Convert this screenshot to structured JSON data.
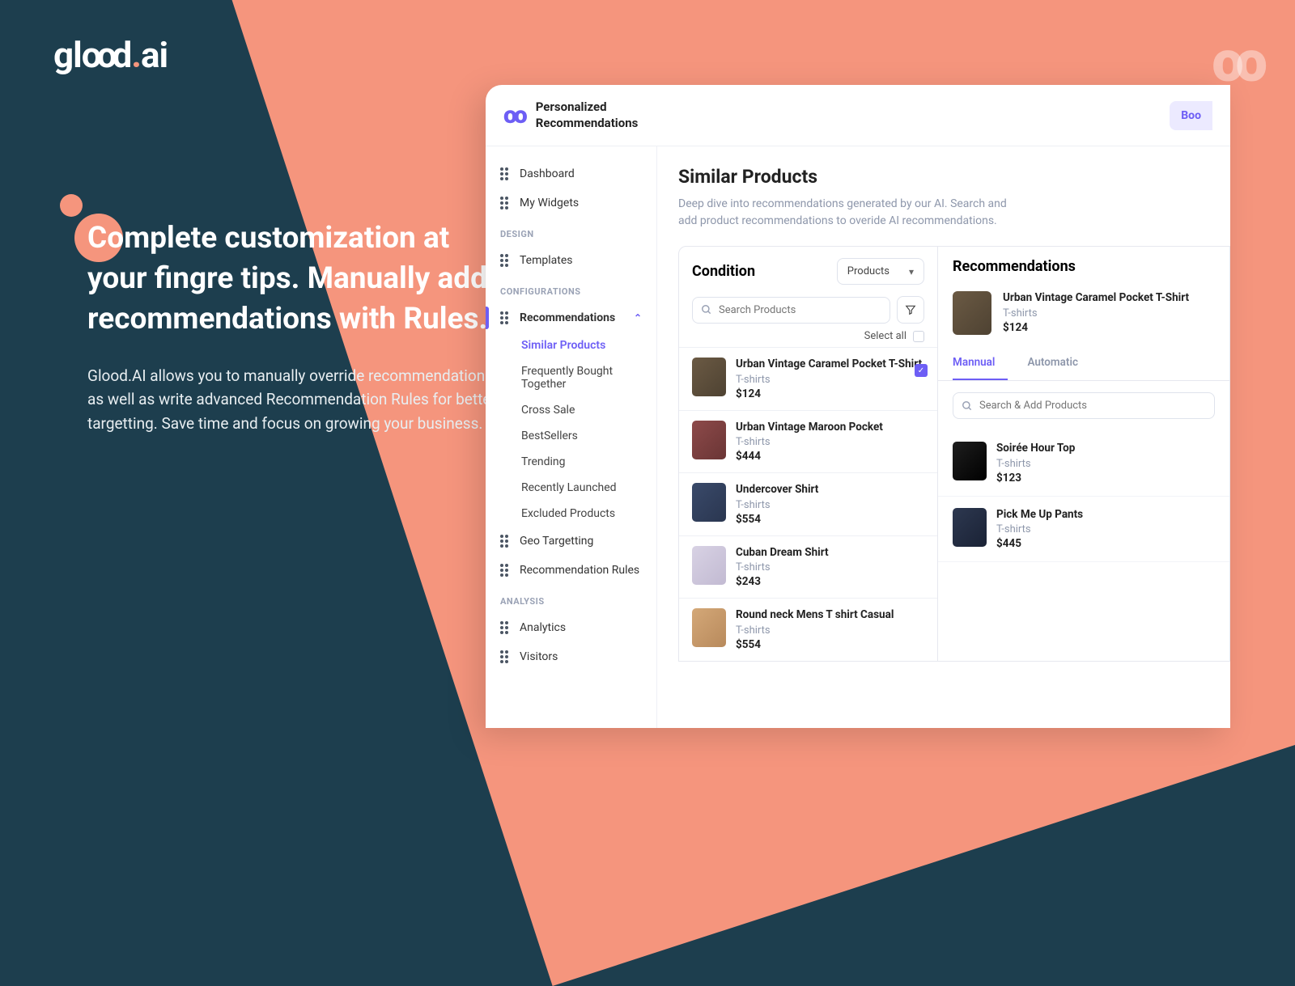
{
  "brand": {
    "name": "glood.ai"
  },
  "marketing": {
    "headline": "Complete customization at your fingre tips. Manually add recommendations with Rules.",
    "body": "Glood.AI allows you to manually override recommendations as well as write advanced Recommendation Rules for better targetting. Save time and focus on growing your business."
  },
  "app": {
    "title_line1": "Personalized",
    "title_line2": "Recommendations",
    "header_btn": "Boo"
  },
  "sidebar": {
    "items_top": [
      {
        "label": "Dashboard"
      },
      {
        "label": "My Widgets"
      }
    ],
    "section_design": "DESIGN",
    "design_items": [
      {
        "label": "Templates"
      }
    ],
    "section_config": "CONFIGURATIONS",
    "config_parent": "Recommendations",
    "config_subs": [
      "Similar Products",
      "Frequently Bought Together",
      "Cross Sale",
      "BestSellers",
      "Trending",
      "Recently Launched",
      "Excluded Products"
    ],
    "config_rest": [
      {
        "label": "Geo Targetting"
      },
      {
        "label": "Recommendation Rules"
      }
    ],
    "section_analysis": "ANALYSIS",
    "analysis_items": [
      {
        "label": "Analytics"
      },
      {
        "label": "Visitors"
      }
    ]
  },
  "main": {
    "title": "Similar Products",
    "desc": "Deep dive into recommendations generated by our AI. Search and add product recommendations to overide AI recommendations.",
    "condition_label": "Condition",
    "dropdown_value": "Products",
    "search_placeholder": "Search Products",
    "select_all": "Select all",
    "products": [
      {
        "name": "Urban Vintage Caramel Pocket T-Shirt",
        "cat": "T-shirts",
        "price": "$124",
        "checked": true,
        "thumb": "t1"
      },
      {
        "name": "Urban Vintage Maroon Pocket",
        "cat": "T-shirts",
        "price": "$444",
        "thumb": "t2"
      },
      {
        "name": "Undercover Shirt",
        "cat": "T-shirts",
        "price": "$554",
        "thumb": "t3"
      },
      {
        "name": "Cuban Dream Shirt",
        "cat": "T-shirts",
        "price": "$243",
        "thumb": "t4"
      },
      {
        "name": "Round neck Mens T shirt Casual",
        "cat": "T-shirts",
        "price": "$554",
        "thumb": "t5"
      }
    ]
  },
  "rec": {
    "title": "Recommendations",
    "selected": {
      "name": "Urban Vintage Caramel Pocket T-Shirt",
      "cat": "T-shirts",
      "price": "$124",
      "thumb": "t1"
    },
    "tabs": {
      "manual": "Mannual",
      "automatic": "Automatic"
    },
    "search_placeholder": "Search & Add Products",
    "items": [
      {
        "name": "Soirée Hour Top",
        "cat": "T-shirts",
        "price": "$123",
        "thumb": "t6"
      },
      {
        "name": "Pick Me Up Pants",
        "cat": "T-shirts",
        "price": "$445",
        "thumb": "t7"
      }
    ]
  }
}
